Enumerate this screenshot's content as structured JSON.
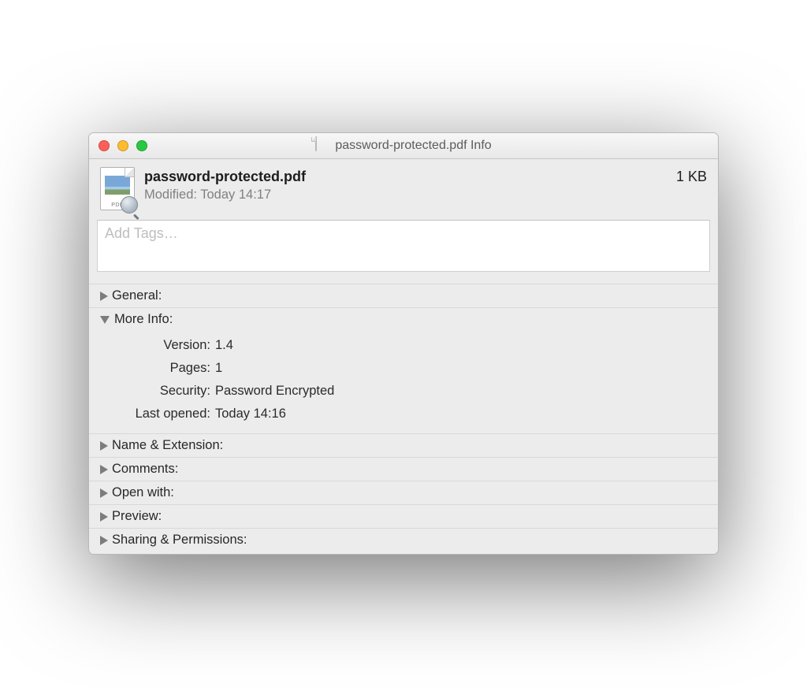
{
  "titlebar": {
    "proxy_icon_name": "pdf-file-icon",
    "title": "password-protected.pdf Info"
  },
  "header": {
    "file_icon_label": "PDF",
    "file_name": "password-protected.pdf",
    "modified_prefix": "Modified:",
    "modified_value": "Today 14:17",
    "size": "1 KB"
  },
  "tags": {
    "placeholder": "Add Tags…",
    "value": ""
  },
  "sections": {
    "general": {
      "label": "General:",
      "expanded": false
    },
    "more_info": {
      "label": "More Info:",
      "expanded": true,
      "rows": {
        "version": {
          "label": "Version:",
          "value": "1.4"
        },
        "pages": {
          "label": "Pages:",
          "value": "1"
        },
        "security": {
          "label": "Security:",
          "value": "Password Encrypted"
        },
        "last_opened": {
          "label": "Last opened:",
          "value": "Today 14:16"
        }
      }
    },
    "name_ext": {
      "label": "Name & Extension:",
      "expanded": false
    },
    "comments": {
      "label": "Comments:",
      "expanded": false
    },
    "open_with": {
      "label": "Open with:",
      "expanded": false
    },
    "preview": {
      "label": "Preview:",
      "expanded": false
    },
    "sharing": {
      "label": "Sharing & Permissions:",
      "expanded": false
    }
  }
}
